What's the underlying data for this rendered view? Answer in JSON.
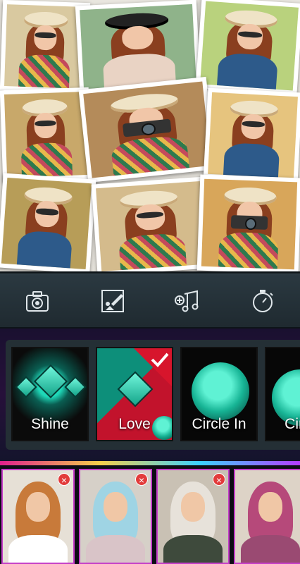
{
  "collage": {
    "photos": [
      {
        "name": "collage-photo-1",
        "hat": "light",
        "body": "floral"
      },
      {
        "name": "collage-photo-2",
        "hat": "dark",
        "body": "plain"
      },
      {
        "name": "collage-photo-3",
        "hat": "light",
        "body": "plain"
      },
      {
        "name": "collage-photo-4",
        "hat": "light",
        "body": "floral"
      },
      {
        "name": "collage-photo-5",
        "hat": "light",
        "body": "floral",
        "camera": true
      },
      {
        "name": "collage-photo-6",
        "hat": "light",
        "body": "plain"
      },
      {
        "name": "collage-photo-7",
        "hat": "light",
        "body": "plain"
      },
      {
        "name": "collage-photo-8",
        "hat": "light",
        "body": "floral"
      },
      {
        "name": "collage-photo-9",
        "hat": "light",
        "body": "floral",
        "camera": true
      }
    ]
  },
  "toolbar": {
    "tools": [
      {
        "name": "camera-icon",
        "action": "add photo"
      },
      {
        "name": "edit-image-icon",
        "action": "edit"
      },
      {
        "name": "add-music-icon",
        "action": "add music"
      },
      {
        "name": "timer-icon",
        "action": "duration"
      }
    ]
  },
  "effects": {
    "items": [
      {
        "label": "Shine",
        "selected": false
      },
      {
        "label": "Love",
        "selected": true
      },
      {
        "label": "Circle In",
        "selected": false
      },
      {
        "label": "Circle",
        "selected": false
      }
    ]
  },
  "selected_photos": {
    "items": [
      {
        "hijab": "#c87a3a",
        "torso": "#ffffff",
        "bg": "#e6e0d6"
      },
      {
        "hijab": "#9fd4e4",
        "torso": "#d9c4c8",
        "bg": "#d6d0c8"
      },
      {
        "hijab": "#e7e2da",
        "torso": "#3e4a3c",
        "bg": "#c9c1b4"
      },
      {
        "hijab": "#b6497a",
        "torso": "#9a4a72",
        "bg": "#ddd3c7"
      }
    ],
    "remove_symbol": "×"
  },
  "colors": {
    "accent": "#1fd8b8",
    "checkmark": "#d7152c",
    "toolbar": "#2b3941",
    "remove": "#e23b3b"
  }
}
